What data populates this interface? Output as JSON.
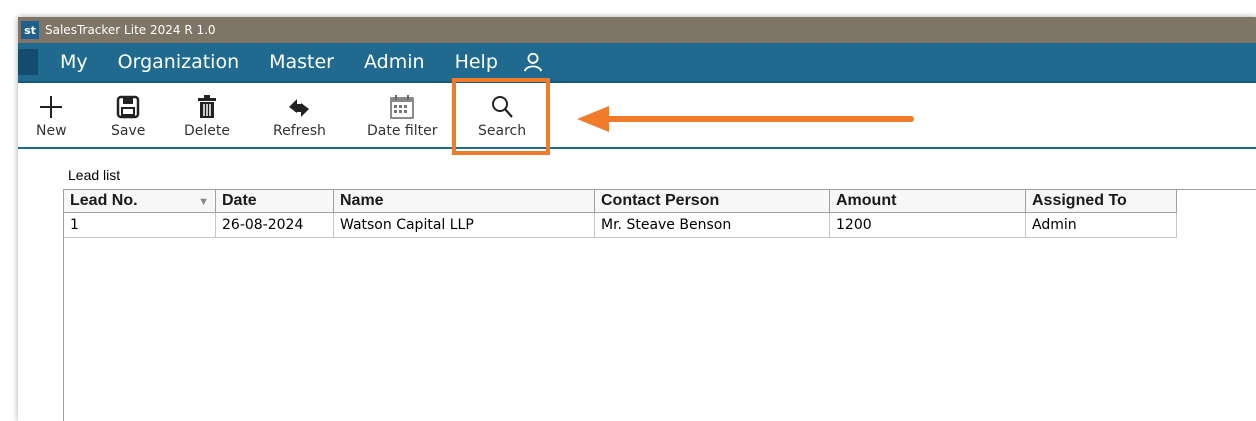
{
  "window": {
    "title": "SalesTracker Lite 2024 R 1.0",
    "app_icon_text": "st"
  },
  "menu": {
    "items": [
      "My",
      "Organization",
      "Master",
      "Admin",
      "Help"
    ]
  },
  "toolbar": {
    "new_label": "New",
    "save_label": "Save",
    "delete_label": "Delete",
    "refresh_label": "Refresh",
    "date_filter_label": "Date filter",
    "search_label": "Search"
  },
  "annotation": {
    "highlight_color": "#f07c2b"
  },
  "lead_list": {
    "label": "Lead list",
    "columns": [
      "Lead No.",
      "Date",
      "Name",
      "Contact Person",
      "Amount",
      "Assigned To"
    ],
    "rows": [
      [
        "1",
        "26-08-2024",
        "Watson Capital LLP",
        "Mr. Steave Benson",
        "1200",
        "Admin"
      ]
    ]
  },
  "colors": {
    "titlebar": "#7e7566",
    "menubar": "#1f6a8e"
  }
}
